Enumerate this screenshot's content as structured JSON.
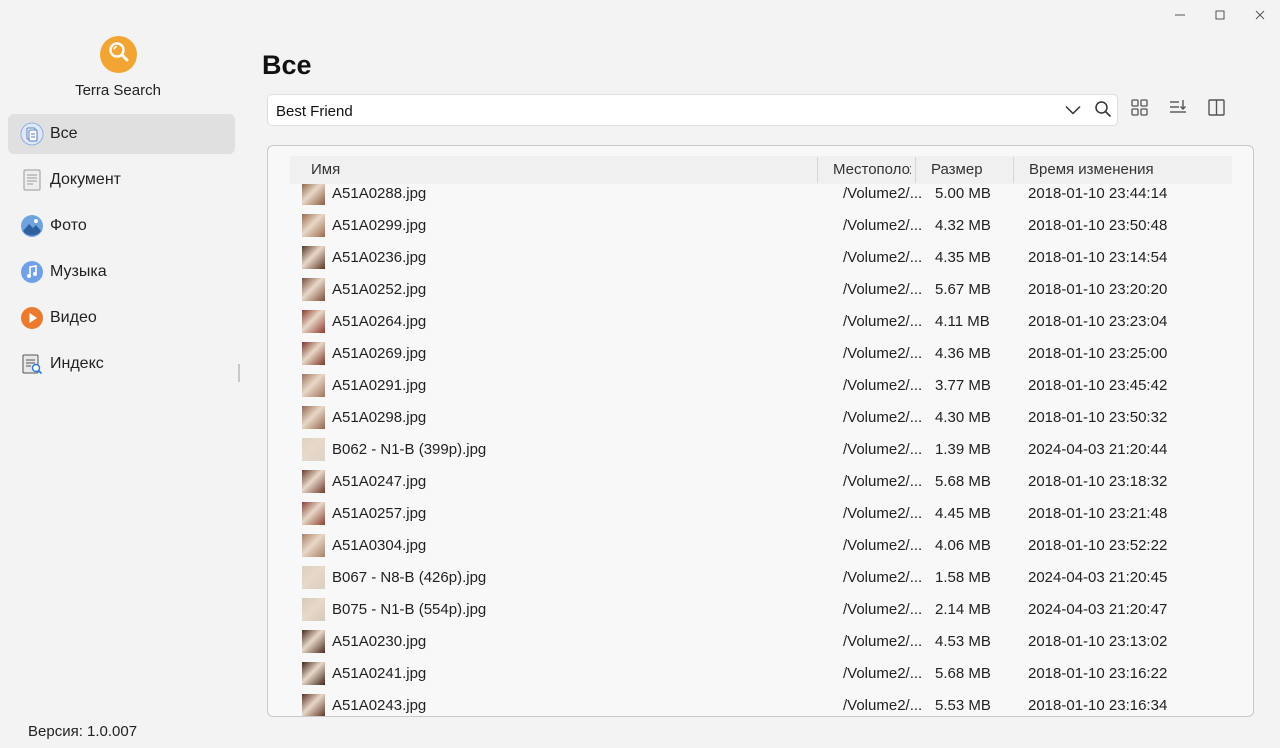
{
  "window": {
    "minimize_icon": "minimize-icon",
    "maximize_icon": "maximize-icon",
    "close_icon": "close-icon"
  },
  "app": {
    "name": "Terra Search",
    "version": "Версия: 1.0.007",
    "accent": "#f2a532"
  },
  "sidebar": {
    "items": [
      {
        "label": "Все",
        "icon": "all-files-icon",
        "active": true
      },
      {
        "label": "Документ",
        "icon": "document-icon",
        "active": false
      },
      {
        "label": "Фото",
        "icon": "photo-icon",
        "active": false
      },
      {
        "label": "Музыка",
        "icon": "music-icon",
        "active": false
      },
      {
        "label": "Видео",
        "icon": "video-icon",
        "active": false
      },
      {
        "label": "Индекс",
        "icon": "index-icon",
        "active": false
      }
    ]
  },
  "main": {
    "title": "Все",
    "search": {
      "value": "Best Friend"
    },
    "toolbar": {
      "grid_view_icon": "grid-view-icon",
      "sort_icon": "sort-icon",
      "panel_icon": "preview-pane-icon"
    }
  },
  "table": {
    "columns": [
      "Имя",
      "Местоположение",
      "Размер",
      "Время изменения"
    ],
    "rows": [
      {
        "name": "A51A0288.jpg",
        "location": "/Volume2/...",
        "size": "5.00 MB",
        "modified": "2018-01-10 23:44:14",
        "thumb": "#8a5a3c"
      },
      {
        "name": "A51A0299.jpg",
        "location": "/Volume2/...",
        "size": "4.32 MB",
        "modified": "2018-01-10 23:50:48",
        "thumb": "#9c6a4a"
      },
      {
        "name": "A51A0236.jpg",
        "location": "/Volume2/...",
        "size": "4.35 MB",
        "modified": "2018-01-10 23:14:54",
        "thumb": "#5a3422"
      },
      {
        "name": "A51A0252.jpg",
        "location": "/Volume2/...",
        "size": "5.67 MB",
        "modified": "2018-01-10 23:20:20",
        "thumb": "#7a4e38"
      },
      {
        "name": "A51A0264.jpg",
        "location": "/Volume2/...",
        "size": "4.11 MB",
        "modified": "2018-01-10 23:23:04",
        "thumb": "#8c3a2a"
      },
      {
        "name": "A51A0269.jpg",
        "location": "/Volume2/...",
        "size": "4.36 MB",
        "modified": "2018-01-10 23:25:00",
        "thumb": "#7e3426"
      },
      {
        "name": "A51A0291.jpg",
        "location": "/Volume2/...",
        "size": "3.77 MB",
        "modified": "2018-01-10 23:45:42",
        "thumb": "#a07258"
      },
      {
        "name": "A51A0298.jpg",
        "location": "/Volume2/...",
        "size": "4.30 MB",
        "modified": "2018-01-10 23:50:32",
        "thumb": "#94664c"
      },
      {
        "name": "B062 - N1-B (399p).jpg",
        "location": "/Volume2/...",
        "size": "1.39 MB",
        "modified": "2024-04-03 21:20:44",
        "thumb": "#dcd4c8"
      },
      {
        "name": "A51A0247.jpg",
        "location": "/Volume2/...",
        "size": "5.68 MB",
        "modified": "2018-01-10 23:18:32",
        "thumb": "#6e3a2a"
      },
      {
        "name": "A51A0257.jpg",
        "location": "/Volume2/...",
        "size": "4.45 MB",
        "modified": "2018-01-10 23:21:48",
        "thumb": "#8a4030"
      },
      {
        "name": "A51A0304.jpg",
        "location": "/Volume2/...",
        "size": "4.06 MB",
        "modified": "2018-01-10 23:52:22",
        "thumb": "#a88062"
      },
      {
        "name": "B067 - N8-B (426p).jpg",
        "location": "/Volume2/...",
        "size": "1.58 MB",
        "modified": "2024-04-03 21:20:45",
        "thumb": "#d8cfc2"
      },
      {
        "name": "B075 - N1-B (554p).jpg",
        "location": "/Volume2/...",
        "size": "2.14 MB",
        "modified": "2024-04-03 21:20:47",
        "thumb": "#d4cabc"
      },
      {
        "name": "A51A0230.jpg",
        "location": "/Volume2/...",
        "size": "4.53 MB",
        "modified": "2018-01-10 23:13:02",
        "thumb": "#4a2a1e"
      },
      {
        "name": "A51A0241.jpg",
        "location": "/Volume2/...",
        "size": "5.68 MB",
        "modified": "2018-01-10 23:16:22",
        "thumb": "#3e2418"
      },
      {
        "name": "A51A0243.jpg",
        "location": "/Volume2/...",
        "size": "5.53 MB",
        "modified": "2018-01-10 23:16:34",
        "thumb": "#5c3020"
      }
    ]
  }
}
